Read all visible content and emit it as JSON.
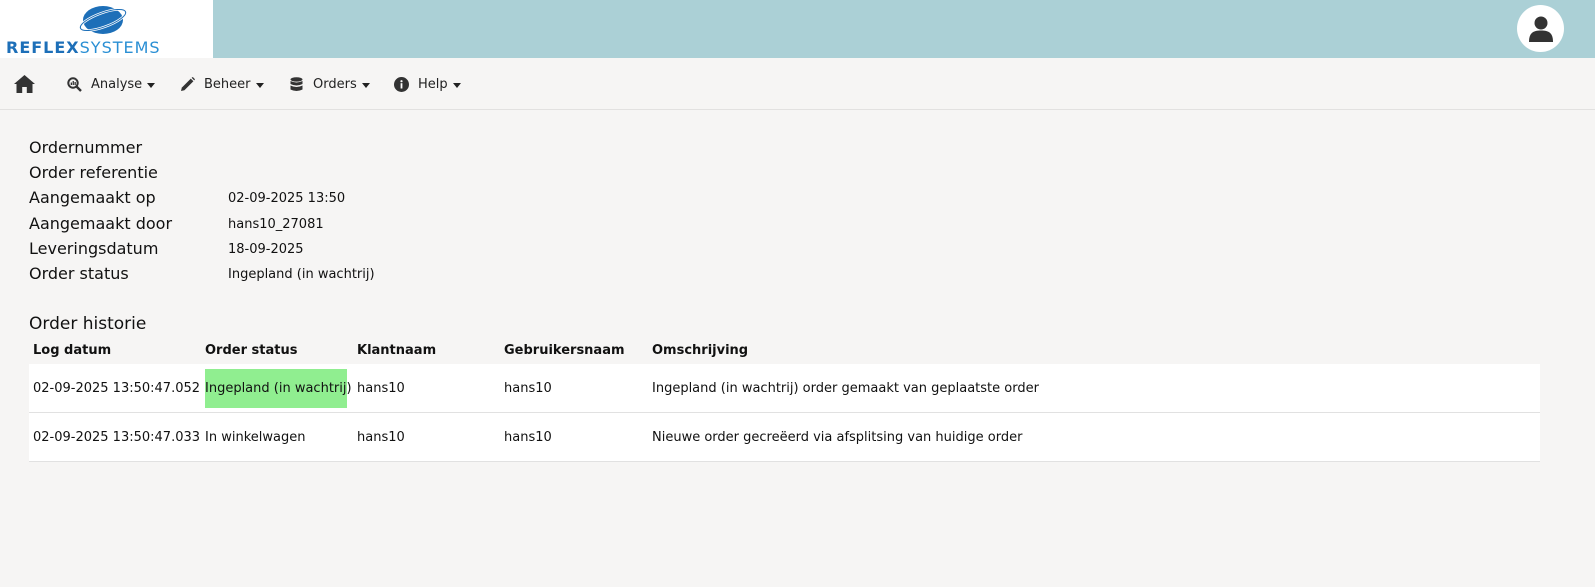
{
  "brand": {
    "part1": "REFLEX",
    "part2": "SYSTEMS",
    "colors": {
      "primary": "#1d6fb8",
      "secondary": "#2a8fd4",
      "header_bg": "#abd0d6",
      "highlight": "#90ee90"
    }
  },
  "header": {
    "avatar_icon": "user-icon"
  },
  "nav": {
    "home_icon": "home-icon",
    "items": [
      {
        "label": "Analyse",
        "icon": "analytics-icon"
      },
      {
        "label": "Beheer",
        "icon": "pencil-icon"
      },
      {
        "label": "Orders",
        "icon": "database-icon"
      },
      {
        "label": "Help",
        "icon": "info-icon"
      }
    ]
  },
  "order": {
    "fields": [
      {
        "label": "Ordernummer",
        "value": ""
      },
      {
        "label": "Order referentie",
        "value": ""
      },
      {
        "label": "Aangemaakt op",
        "value": "02-09-2025 13:50"
      },
      {
        "label": "Aangemaakt door",
        "value": "hans10_27081"
      },
      {
        "label": "Leveringsdatum",
        "value": "18-09-2025"
      },
      {
        "label": "Order status",
        "value": "Ingepland (in wachtrij)"
      }
    ]
  },
  "history": {
    "title": "Order historie",
    "columns": [
      "Log datum",
      "Order status",
      "Klantnaam",
      "Gebruikersnaam",
      "Omschrijving"
    ],
    "rows": [
      {
        "log_datum": "02-09-2025 13:50:47.052",
        "order_status": "Ingepland (in wachtrij)",
        "klantnaam": "hans10",
        "gebruikersnaam": "hans10",
        "omschrijving": "Ingepland (in wachtrij) order gemaakt van geplaatste order",
        "highlight": true
      },
      {
        "log_datum": "02-09-2025 13:50:47.033",
        "order_status": "In winkelwagen",
        "klantnaam": "hans10",
        "gebruikersnaam": "hans10",
        "omschrijving": "Nieuwe order gecreëerd via afsplitsing van huidige order",
        "highlight": false
      }
    ]
  }
}
